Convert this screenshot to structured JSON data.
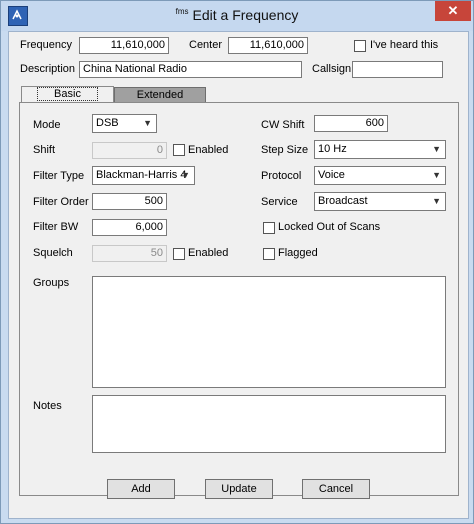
{
  "window": {
    "title_prefix": "fms",
    "title": "Edit a Frequency",
    "close_glyph": "✕"
  },
  "top": {
    "frequency_label": "Frequency",
    "frequency_value": "11,610,000",
    "center_label": "Center",
    "center_value": "11,610,000",
    "heard_label": "I've heard this",
    "heard_checked": false,
    "description_label": "Description",
    "description_value": "China National Radio",
    "callsign_label": "Callsign",
    "callsign_value": ""
  },
  "tabs": [
    {
      "label": "Basic",
      "active": true
    },
    {
      "label": "Extended",
      "active": false
    }
  ],
  "basic": {
    "mode_label": "Mode",
    "mode_value": "DSB",
    "shift_label": "Shift",
    "shift_value": "0",
    "shift_enabled_label": "Enabled",
    "filter_type_label": "Filter Type",
    "filter_type_value": "Blackman-Harris 4",
    "filter_order_label": "Filter Order",
    "filter_order_value": "500",
    "filter_bw_label": "Filter BW",
    "filter_bw_value": "6,000",
    "squelch_label": "Squelch",
    "squelch_value": "50",
    "squelch_enabled_label": "Enabled",
    "cw_shift_label": "CW Shift",
    "cw_shift_value": "600",
    "step_size_label": "Step Size",
    "step_size_value": "10 Hz",
    "protocol_label": "Protocol",
    "protocol_value": "Voice",
    "service_label": "Service",
    "service_value": "Broadcast",
    "locked_label": "Locked Out of Scans",
    "flagged_label": "Flagged",
    "groups_label": "Groups",
    "notes_label": "Notes"
  },
  "buttons": {
    "add": "Add",
    "update": "Update",
    "cancel": "Cancel"
  },
  "icons": {
    "app": "fms-logo-icon",
    "close": "close-icon",
    "dropdown": "chevron-down-icon"
  },
  "colors": {
    "titlebar": "#c5d8ef",
    "close": "#c7453a",
    "client": "#f0f0f0"
  }
}
